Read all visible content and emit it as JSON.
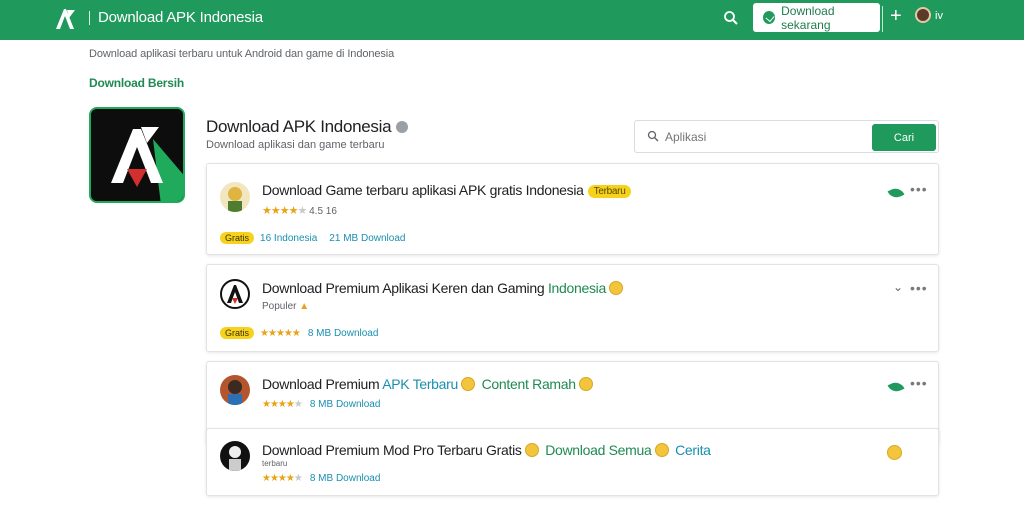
{
  "topbar": {
    "title": "Download APK Indonesia",
    "download_button": "Download sekarang",
    "user": "iv",
    "icons": {
      "search": "search-icon",
      "add": "plus-icon",
      "chat": "chat-icon",
      "logo": "apk-logo-icon"
    }
  },
  "breadcrumb": "Download aplikasi terbaru untuk Android dan game di Indonesia",
  "section_link": "Download Bersih",
  "panel": {
    "title": "Download APK Indonesia",
    "subtitle": "Download aplikasi dan game terbaru",
    "search_placeholder": "Aplikasi",
    "search_button": "Cari"
  },
  "cards": [
    {
      "title": "Download Game terbaru aplikasi APK gratis Indonesia",
      "badge": "Terbaru",
      "meta_rating": "4.5",
      "meta_extra": "16",
      "foot_pill": "Gratis",
      "foot_a": "16 Indonesia",
      "foot_b": "21 MB Download"
    },
    {
      "title_a": "Download Premium",
      "title_b": "Aplikasi Keren dan Gaming",
      "title_green": "Indonesia",
      "meta": "Populer",
      "foot_pill": "Gratis",
      "foot_b": "8 MB Download"
    },
    {
      "title_a": "Download Premium",
      "title_accent": "APK Terbaru",
      "title_green": "Content Ramah",
      "foot_b": "8 MB Download"
    },
    {
      "title_a": "Download Premium Mod Pro Terbaru Gratis",
      "title_green": "Download Semua",
      "title_accent": "Cerita",
      "meta": "terbaru",
      "foot_b": "8 MB Download"
    }
  ]
}
